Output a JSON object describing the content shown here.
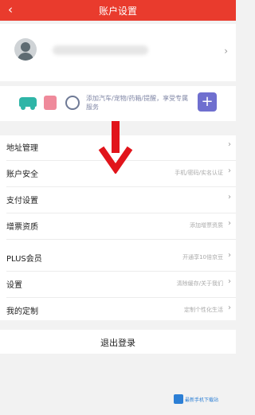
{
  "header": {
    "back_icon": "chevron-left-icon",
    "title": "账户设置"
  },
  "profile": {
    "avatar_icon": "user-avatar-icon",
    "chevron": "›"
  },
  "assist": {
    "text": "添加汽车/宠物/药箱/提醒，享受专属服务",
    "plus_label": "+"
  },
  "menu": [
    {
      "label": "地址管理",
      "value": ""
    },
    {
      "label": "账户安全",
      "value": "手机/密码/实名认证"
    },
    {
      "label": "支付设置",
      "value": ""
    },
    {
      "label": "增票资质",
      "value": "添加增票资质"
    },
    {
      "label": "PLUS会员",
      "value": "开通享10倍京豆"
    },
    {
      "label": "设置",
      "value": "清除缓存/关于我们"
    },
    {
      "label": "我的定制",
      "value": "定制个性化生活"
    }
  ],
  "row_chevron": "›",
  "logout_label": "退出登录",
  "watermark": "最新手机下载站",
  "colors": {
    "primary": "#e93b2d",
    "arrow": "#e1141b"
  }
}
